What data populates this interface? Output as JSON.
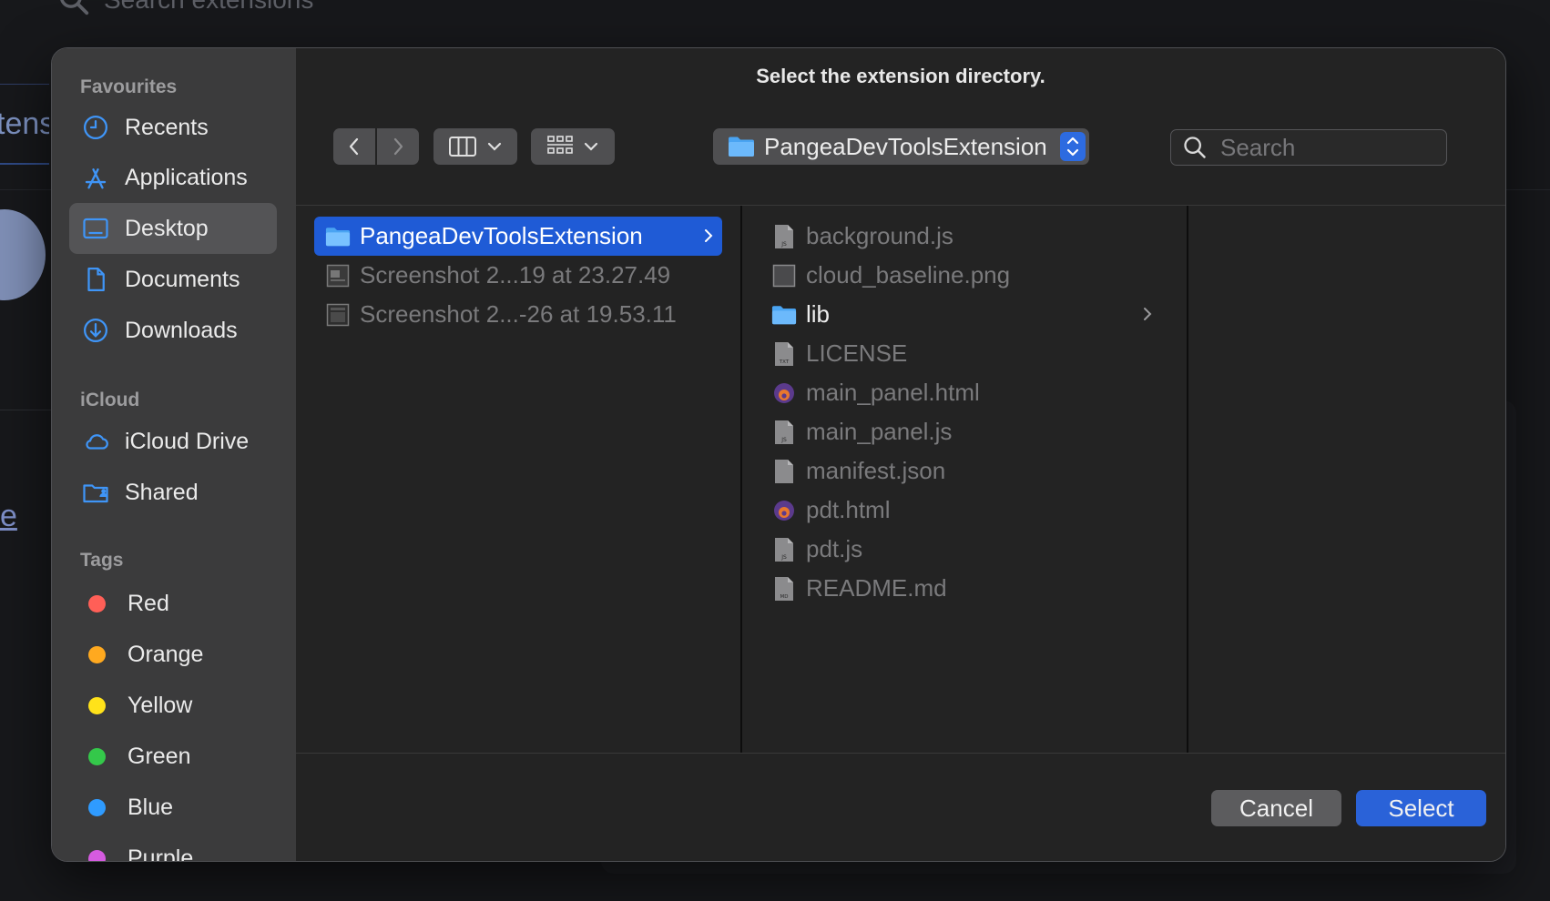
{
  "background": {
    "search_placeholder": "Search extensions",
    "tab_text": "tens",
    "link_text": "e"
  },
  "dialog": {
    "title": "Select the extension directory.",
    "path_popup_label": "PangeaDevToolsExtension",
    "search_placeholder": "Search",
    "cancel_label": "Cancel",
    "select_label": "Select",
    "accent_color": "#2a62d8"
  },
  "sidebar": {
    "favourites_heading": "Favourites",
    "favourites": [
      {
        "label": "Recents",
        "icon": "clock-icon"
      },
      {
        "label": "Applications",
        "icon": "applications-icon"
      },
      {
        "label": "Desktop",
        "icon": "desktop-icon",
        "selected": true
      },
      {
        "label": "Documents",
        "icon": "document-icon"
      },
      {
        "label": "Downloads",
        "icon": "download-icon"
      }
    ],
    "icloud_heading": "iCloud",
    "icloud": [
      {
        "label": "iCloud Drive",
        "icon": "cloud-icon"
      },
      {
        "label": "Shared",
        "icon": "shared-folder-icon"
      }
    ],
    "tags_heading": "Tags",
    "tags": [
      {
        "label": "Red",
        "color": "#ff5f57"
      },
      {
        "label": "Orange",
        "color": "#ffa91f"
      },
      {
        "label": "Yellow",
        "color": "#ffe21a"
      },
      {
        "label": "Green",
        "color": "#34c84a"
      },
      {
        "label": "Blue",
        "color": "#2f9bff"
      },
      {
        "label": "Purple",
        "color": "#d55be0"
      }
    ]
  },
  "column1": [
    {
      "name": "PangeaDevToolsExtension",
      "kind": "folder",
      "selected": true
    },
    {
      "name": "Screenshot 2...19 at 23.27.49",
      "kind": "image"
    },
    {
      "name": "Screenshot 2...-26 at 19.53.11",
      "kind": "image"
    }
  ],
  "column2": [
    {
      "name": "background.js",
      "kind": "js-file"
    },
    {
      "name": "cloud_baseline.png",
      "kind": "image"
    },
    {
      "name": "lib",
      "kind": "folder"
    },
    {
      "name": "LICENSE",
      "kind": "txt-file"
    },
    {
      "name": "main_panel.html",
      "kind": "html-file"
    },
    {
      "name": "main_panel.js",
      "kind": "js-file"
    },
    {
      "name": "manifest.json",
      "kind": "file"
    },
    {
      "name": "pdt.html",
      "kind": "html-file"
    },
    {
      "name": "pdt.js",
      "kind": "js-file"
    },
    {
      "name": "README.md",
      "kind": "md-file"
    }
  ]
}
